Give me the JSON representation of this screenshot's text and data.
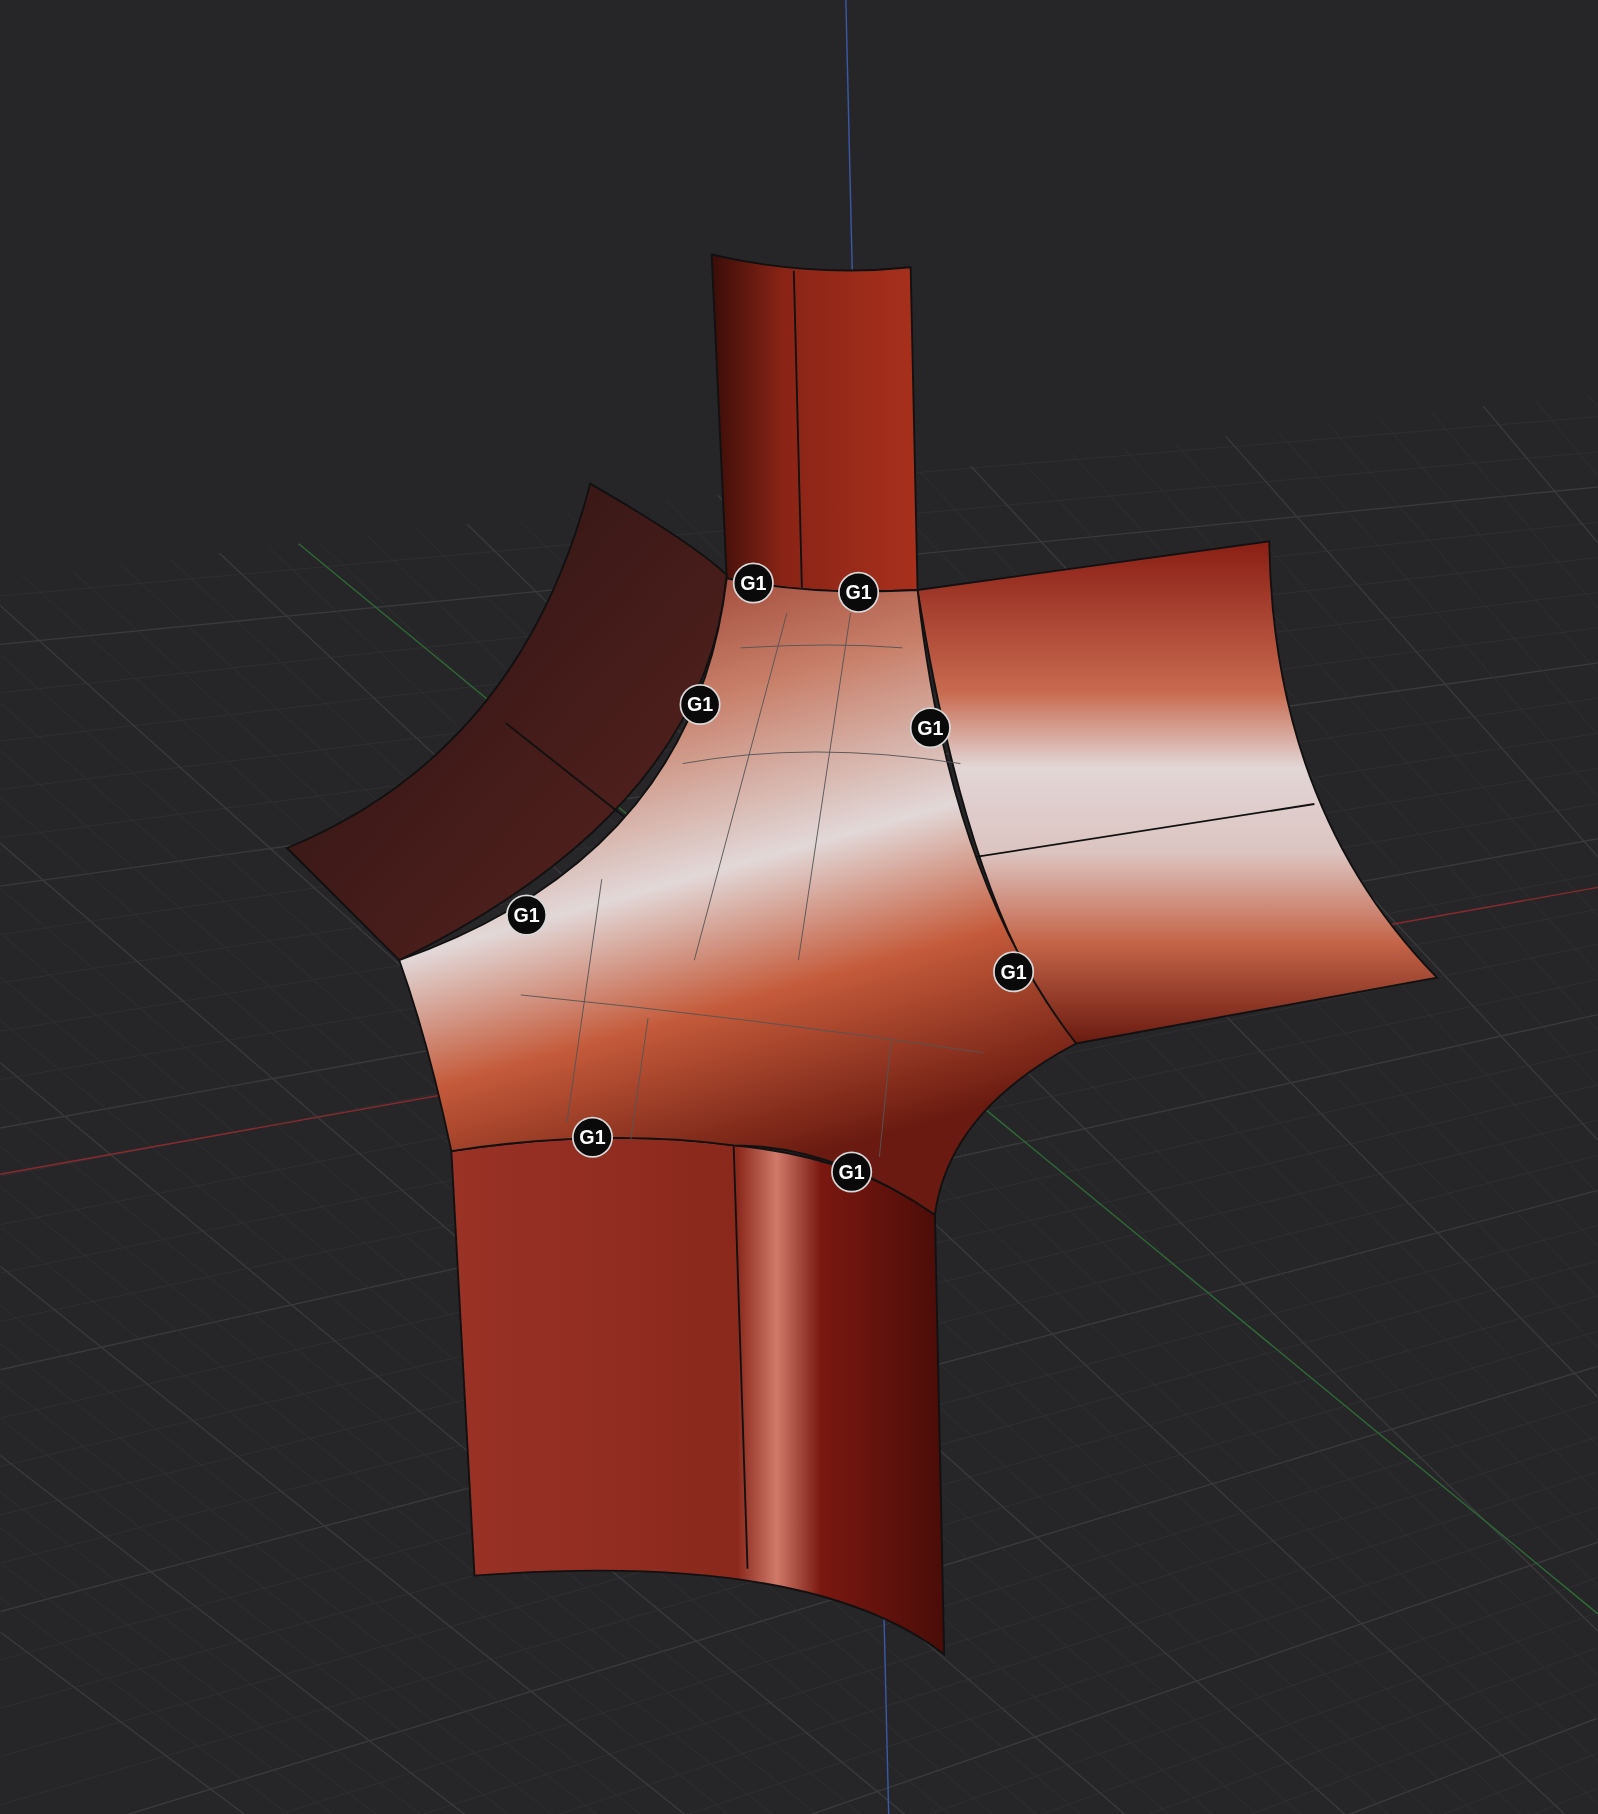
{
  "viewport": {
    "markers": [
      {
        "label": "G1"
      },
      {
        "label": "G1"
      },
      {
        "label": "G1"
      },
      {
        "label": "G1"
      },
      {
        "label": "G1"
      },
      {
        "label": "G1"
      },
      {
        "label": "G1"
      },
      {
        "label": "G1"
      }
    ]
  }
}
